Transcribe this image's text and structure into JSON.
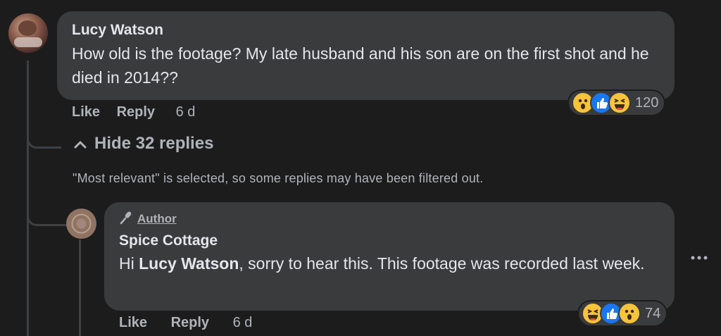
{
  "comment": {
    "author": "Lucy Watson",
    "text": "How old is the footage? My late husband and his son are on the first shot and he died in 2014??",
    "actions": {
      "like": "Like",
      "reply": "Reply",
      "time": "6 d"
    },
    "reactions": {
      "icons": [
        "wow-emoji",
        "like-emoji",
        "haha-emoji"
      ],
      "count": "120"
    }
  },
  "replies_toggle": {
    "label": "Hide 32 replies",
    "icon": "chevron-up-icon"
  },
  "filter_notice": "\"Most relevant\" is selected, so some replies may have been filtered out.",
  "reply": {
    "badge": "Author",
    "badge_icon": "microphone-icon",
    "author": "Spice Cottage",
    "text_prefix": "Hi ",
    "mention": "Lucy Watson",
    "text_suffix": ", sorry to hear this. This footage was recorded last week.",
    "actions": {
      "like": "Like",
      "reply": "Reply",
      "time": "6 d"
    },
    "reactions": {
      "icons": [
        "haha-emoji",
        "like-emoji",
        "wow-emoji"
      ],
      "count": "74"
    },
    "more_icon": "more-options-icon"
  },
  "colors": {
    "background": "#1c1c1d",
    "bubble": "#3a3b3c",
    "text": "#e4e6eb",
    "secondary": "#b0b3b8",
    "like_blue": "#1877f2",
    "emoji_yellow": "#f7c33b"
  }
}
